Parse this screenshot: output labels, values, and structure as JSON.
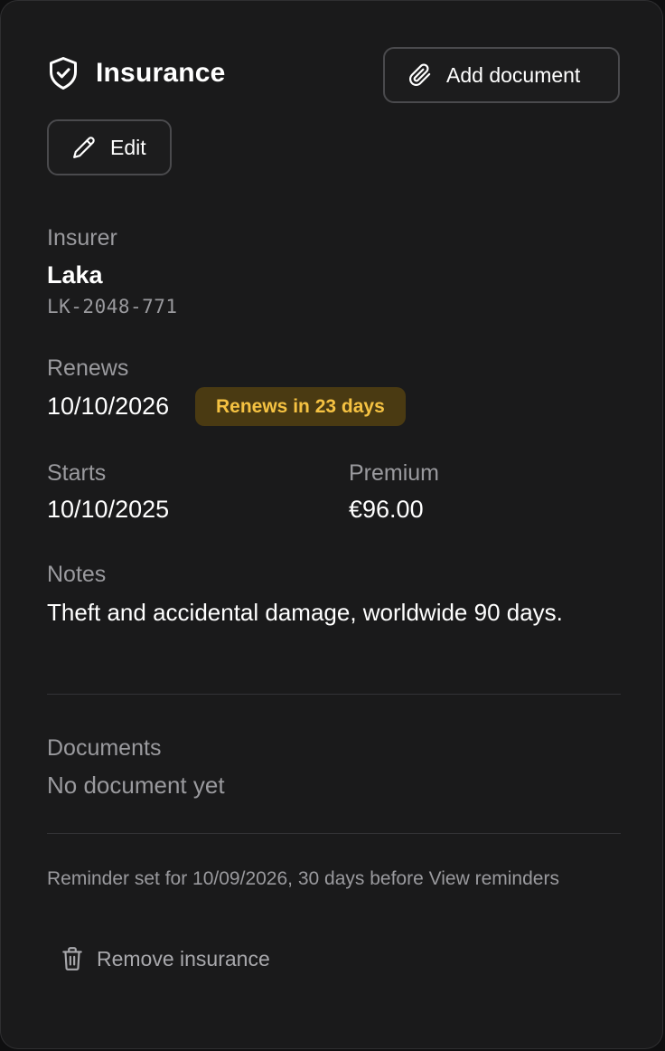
{
  "header": {
    "title": "Insurance",
    "title_icon": "shield-check-icon",
    "add_document_label": "Add document",
    "add_document_icon": "paperclip-icon",
    "edit_label": "Edit",
    "edit_icon": "pencil-icon"
  },
  "insurer": {
    "label": "Insurer",
    "name": "Laka",
    "policy_number": "LK-2048-771"
  },
  "renews": {
    "label": "Renews",
    "date": "10/10/2026",
    "badge": "Renews in 23 days",
    "badge_color": "#f5c242"
  },
  "starts": {
    "label": "Starts",
    "date": "10/10/2025"
  },
  "premium": {
    "label": "Premium",
    "amount": "€96.00"
  },
  "notes": {
    "label": "Notes",
    "text": "Theft and accidental damage, worldwide 90 days."
  },
  "documents": {
    "label": "Documents",
    "empty_text": "No document yet"
  },
  "reminder": {
    "text": "Reminder set for 10/09/2026, 30 days before",
    "link": "View reminders"
  },
  "remove": {
    "label": "Remove insurance",
    "icon": "trash-icon"
  }
}
